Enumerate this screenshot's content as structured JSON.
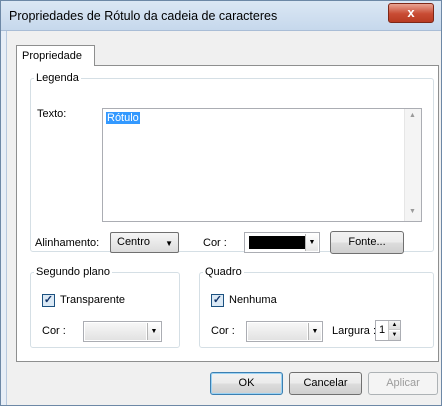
{
  "window": {
    "title": "Propriedades de Rótulo da cadeia de caracteres",
    "close_glyph": "x"
  },
  "tabs": [
    {
      "label": "Propriedade",
      "selected": true
    }
  ],
  "legenda": {
    "group_label": "Legenda",
    "texto_label": "Texto:",
    "texto_value": "Rótulo",
    "alinhamento_label": "Alinhamento:",
    "alinhamento_value": "Centro",
    "cor_label": "Cor :",
    "cor_value_hex": "#000000",
    "fonte_button": "Fonte..."
  },
  "segundo_plano": {
    "group_label": "Segundo plano",
    "transparente_label": "Transparente",
    "transparente_checked": true,
    "cor_label": "Cor :"
  },
  "quadro": {
    "group_label": "Quadro",
    "nenhuma_label": "Nenhuma",
    "nenhuma_checked": true,
    "cor_label": "Cor :",
    "largura_label": "Largura :",
    "largura_value": "1"
  },
  "footer": {
    "ok": "OK",
    "cancelar": "Cancelar",
    "aplicar": "Aplicar"
  },
  "icons": {
    "check": "checkmark-icon",
    "dropdown": "chevron-down-icon",
    "scroll_up": "scroll-up-arrow-icon",
    "scroll_down": "scroll-down-arrow-icon",
    "close": "close-icon"
  }
}
